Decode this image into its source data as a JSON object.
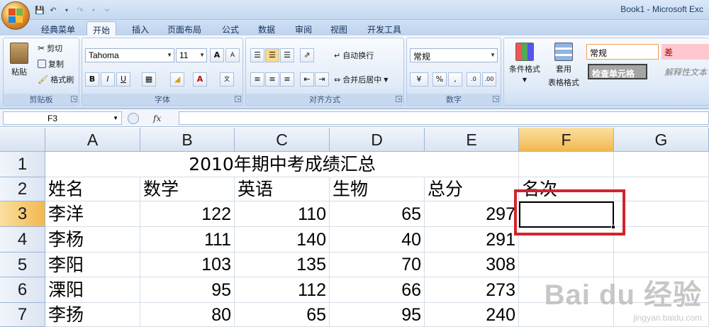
{
  "window": {
    "title": "Book1 - Microsoft Exc"
  },
  "tabs": [
    "经典菜单",
    "开始",
    "插入",
    "页面布局",
    "公式",
    "数据",
    "审阅",
    "视图",
    "开发工具"
  ],
  "ribbon": {
    "clipboard": {
      "label": "剪贴板",
      "paste": "粘贴",
      "cut": "剪切",
      "copy": "复制",
      "format_painter": "格式刷"
    },
    "font": {
      "label": "字体",
      "font_name": "Tahoma",
      "font_size": "11",
      "grow": "A",
      "shrink": "A",
      "bold": "B",
      "italic": "I",
      "underline": "U"
    },
    "alignment": {
      "label": "对齐方式",
      "wrap_text": "自动换行",
      "merge_center": "合并后居中"
    },
    "number": {
      "label": "数字",
      "format": "常规",
      "percent": "%",
      "comma": ","
    },
    "styles": {
      "conditional_format": "条件格式",
      "table_format_1": "套用",
      "table_format_2": "表格格式",
      "normal": "常规",
      "bad": "差",
      "check_cell": "检查单元格",
      "explanatory": "解释性文本"
    }
  },
  "formula_bar": {
    "name_box": "F3",
    "fx": "fx",
    "content": ""
  },
  "sheet": {
    "columns": [
      "A",
      "B",
      "C",
      "D",
      "E",
      "F",
      "G"
    ],
    "rows": [
      "1",
      "2",
      "3",
      "4",
      "5",
      "6",
      "7"
    ],
    "title": "2010年期中考成绩汇总",
    "headers": [
      "姓名",
      "数学",
      "英语",
      "生物",
      "总分",
      "名次"
    ],
    "data": [
      [
        "李洋",
        "122",
        "110",
        "65",
        "297"
      ],
      [
        "李杨",
        "111",
        "140",
        "40",
        "291"
      ],
      [
        "李阳",
        "103",
        "135",
        "70",
        "308"
      ],
      [
        "溧阳",
        "95",
        "112",
        "66",
        "273"
      ],
      [
        "李扬",
        "80",
        "65",
        "95",
        "240"
      ]
    ],
    "selected_cell": "F3"
  },
  "watermark": {
    "brand": "Bai du 经验",
    "url": "jingyan.baidu.com"
  }
}
